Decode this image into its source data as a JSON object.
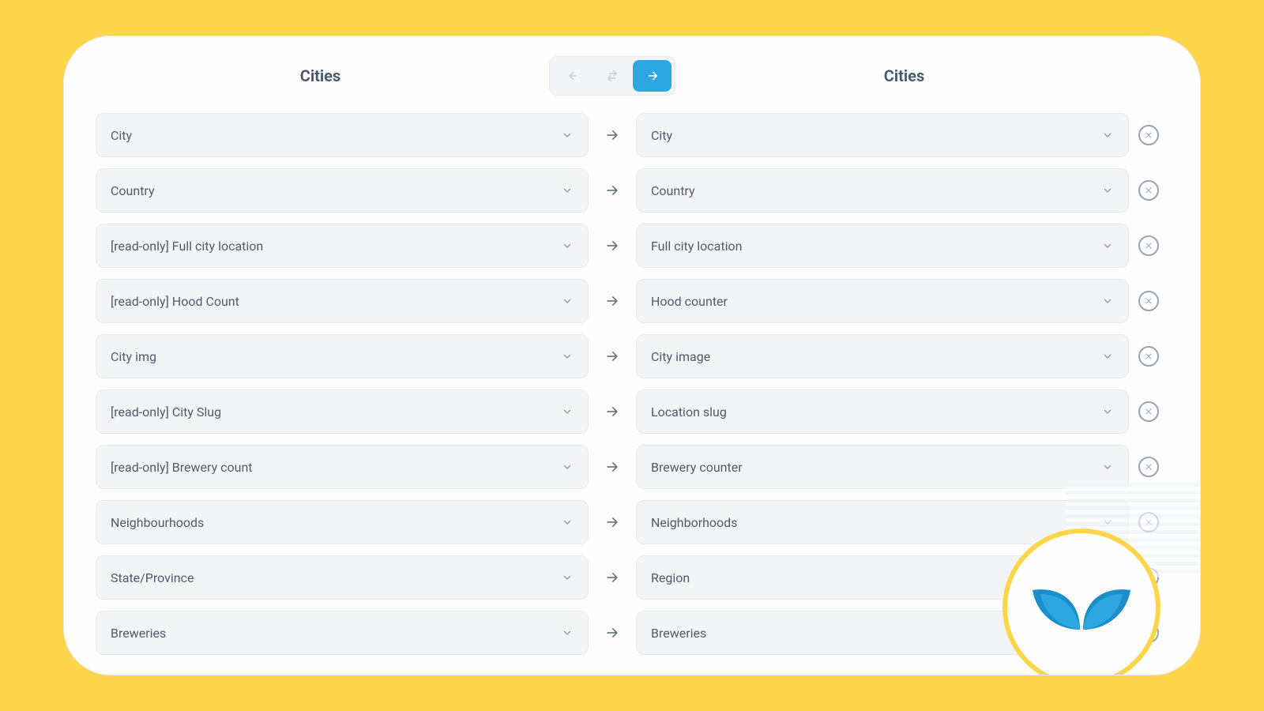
{
  "header": {
    "left_title": "Cities",
    "right_title": "Cities"
  },
  "mappings": [
    {
      "source": "City",
      "target": "City"
    },
    {
      "source": "Country",
      "target": "Country"
    },
    {
      "source": "[read-only] Full city location",
      "target": "Full city location"
    },
    {
      "source": "[read-only] Hood Count",
      "target": "Hood counter"
    },
    {
      "source": "City img",
      "target": "City image"
    },
    {
      "source": "[read-only] City Slug",
      "target": "Location slug"
    },
    {
      "source": "[read-only] Brewery count",
      "target": "Brewery counter"
    },
    {
      "source": "Neighbourhoods",
      "target": "Neighborhoods"
    },
    {
      "source": "State/Province",
      "target": "Region"
    },
    {
      "source": "Breweries",
      "target": "Breweries"
    }
  ]
}
